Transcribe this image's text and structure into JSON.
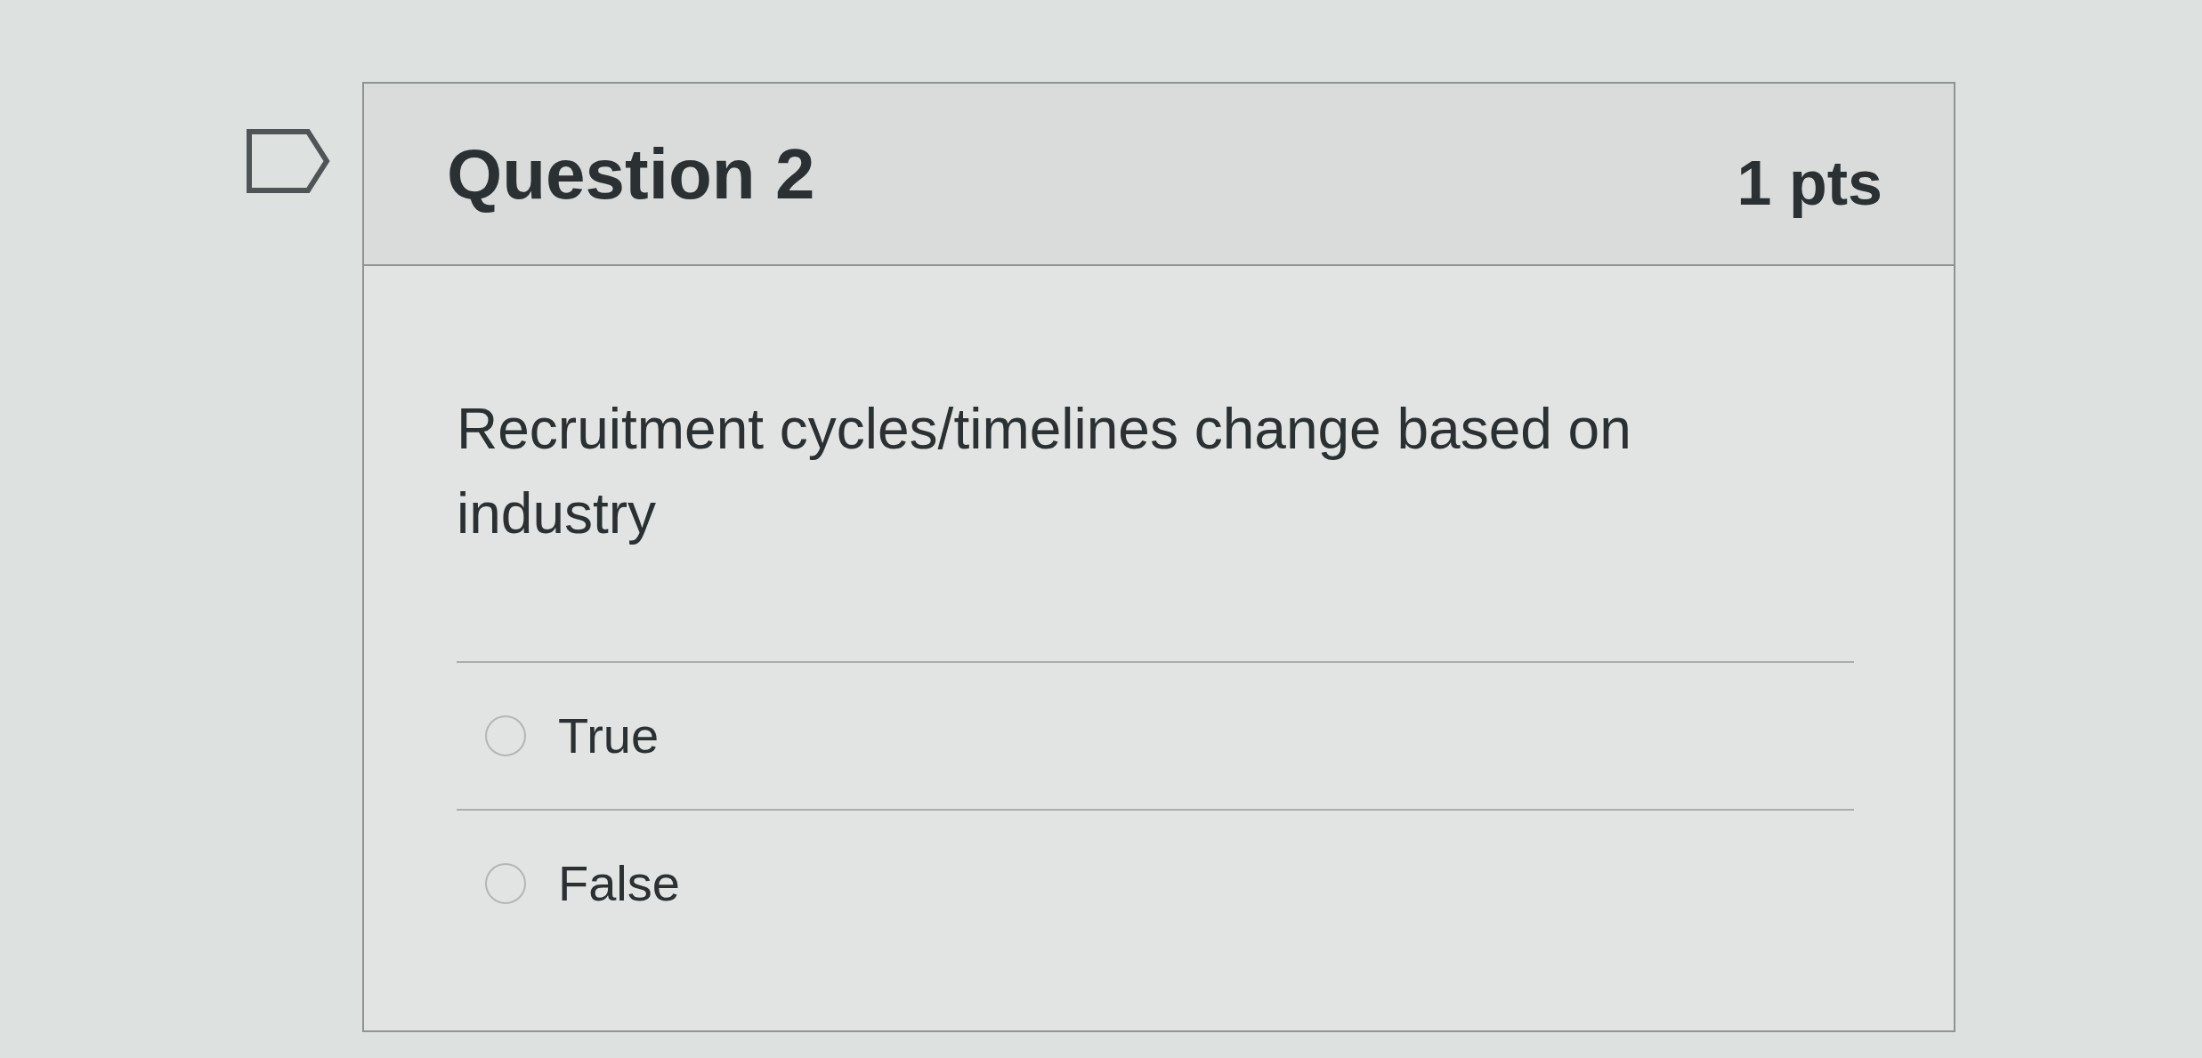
{
  "question": {
    "flagged": false,
    "title": "Question 2",
    "points": "1 pts",
    "text": "Recruitment cycles/timelines change based on industry",
    "answers": [
      {
        "label": "True",
        "selected": false
      },
      {
        "label": "False",
        "selected": false
      }
    ]
  }
}
